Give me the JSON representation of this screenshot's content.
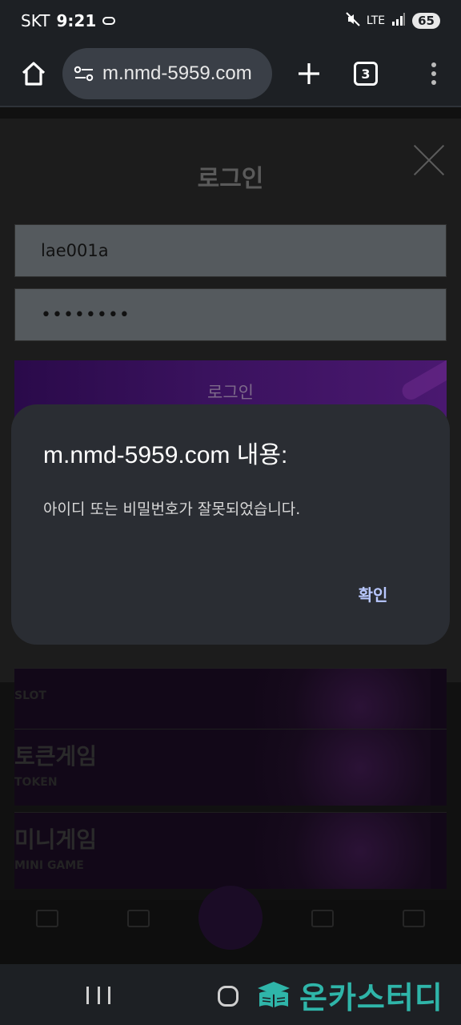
{
  "status_bar": {
    "carrier": "SKT",
    "time": "9:21",
    "network": "LTE",
    "battery": "65"
  },
  "browser": {
    "url": "m.nmd-5959.com",
    "tab_count": "3"
  },
  "page": {
    "login_title": "로그인",
    "username_value": "lae001a",
    "password_value": "••••••••",
    "login_button": "로그인",
    "banners": [
      {
        "title": "",
        "subtitle": "SLOT"
      },
      {
        "title": "토큰게임",
        "subtitle": "TOKEN"
      },
      {
        "title": "미니게임",
        "subtitle": "MINI GAME"
      }
    ]
  },
  "dialog": {
    "title": "m.nmd-5959.com 내용:",
    "message": "아이디 또는 비밀번호가 잘못되었습니다.",
    "ok_label": "확인"
  },
  "watermark": {
    "text": "온카스터디"
  },
  "colors": {
    "dialog_bg": "#2a2d33",
    "ok_accent": "#b9c8ff",
    "watermark": "#2fb5a9"
  }
}
